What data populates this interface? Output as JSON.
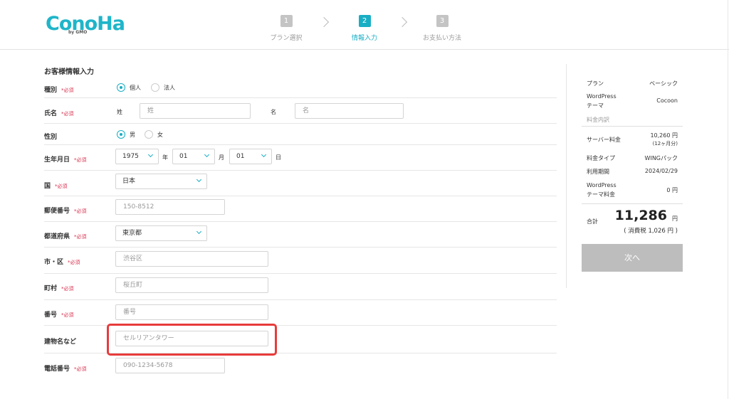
{
  "logo": {
    "main": "ConoHa",
    "sub": "by GMO"
  },
  "steps": [
    {
      "num": "1",
      "label": "プラン選択"
    },
    {
      "num": "2",
      "label": "情報入力"
    },
    {
      "num": "3",
      "label": "お支払い方法"
    }
  ],
  "colors": {
    "accent": "#1aaec4",
    "required": "#d9304e",
    "highlight": "#e83b3b"
  },
  "form": {
    "title": "お客様情報入力",
    "required_mark": "*必須",
    "type": {
      "label": "種別",
      "opt1": "個人",
      "opt2": "法人",
      "selected": "個人"
    },
    "name": {
      "label": "氏名",
      "sei_label": "姓",
      "sei_placeholder": "姓",
      "mei_label": "名",
      "mei_placeholder": "名"
    },
    "gender": {
      "label": "性別",
      "opt1": "男",
      "opt2": "女",
      "selected": "男"
    },
    "birth": {
      "label": "生年月日",
      "year": "1975",
      "year_unit": "年",
      "month": "01",
      "month_unit": "月",
      "day": "01",
      "day_unit": "日"
    },
    "country": {
      "label": "国",
      "value": "日本"
    },
    "postal": {
      "label": "郵便番号",
      "placeholder": "150-8512"
    },
    "prefecture": {
      "label": "都道府県",
      "value": "東京都"
    },
    "city": {
      "label": "市・区",
      "placeholder": "渋谷区"
    },
    "town": {
      "label": "町村",
      "placeholder": "桜丘町"
    },
    "number": {
      "label": "番号",
      "placeholder": "番号"
    },
    "building": {
      "label": "建物名など",
      "placeholder": "セルリアンタワー"
    },
    "phone": {
      "label": "電話番号",
      "placeholder": "090-1234-5678"
    }
  },
  "summary": {
    "plan_key": "プラン",
    "plan_val": "ベーシック",
    "theme_key1": "WordPress",
    "theme_key2": "テーマ",
    "theme_val": "Cocoon",
    "breakdown": "料金内訳",
    "server_key": "サーバー料金",
    "server_val": "10,260 円",
    "server_note": "(12ヶ月分)",
    "ptype_key": "料金タイプ",
    "ptype_val": "WINGパック",
    "period_key": "利用期間",
    "period_val": "2024/02/29",
    "theme_fee_key1": "WordPress",
    "theme_fee_key2": "テーマ料金",
    "theme_fee_val": "0 円",
    "total_key": "合計",
    "total_num": "11,286",
    "total_unit": "円",
    "tax": "( 消費税 1,026 円 )",
    "next": "次へ"
  }
}
